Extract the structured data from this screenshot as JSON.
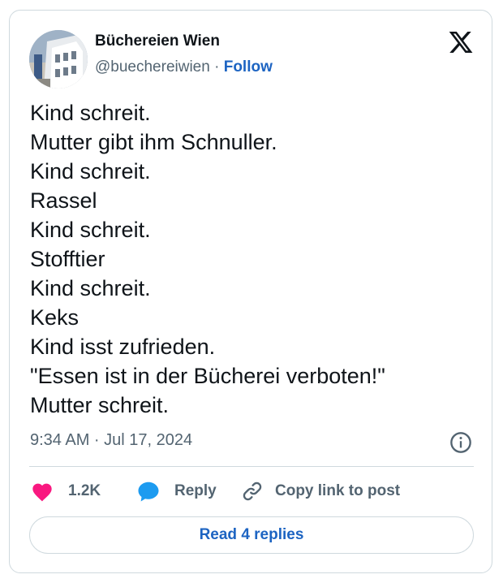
{
  "colors": {
    "accent": "#1d64c2",
    "heart": "#f91880",
    "secondary_text": "#536471",
    "border": "#cfd9de"
  },
  "author": {
    "name": "Büchereien Wien",
    "handle": "@buechereiwien",
    "separator": "·",
    "follow_label": "Follow"
  },
  "tweet": {
    "lines": [
      "Kind schreit.",
      "Mutter gibt ihm Schnuller.",
      "Kind schreit.",
      "Rassel",
      "Kind schreit.",
      "Stofftier",
      "Kind schreit.",
      "Keks",
      "Kind isst zufrieden.",
      "\"Essen ist in der Bücherei verboten!\"",
      "Mutter schreit."
    ],
    "timestamp": "9:34 AM · Jul 17, 2024"
  },
  "actions": {
    "like_count": "1.2K",
    "reply_label": "Reply",
    "copy_link_label": "Copy link to post"
  },
  "read_replies_label": "Read 4 replies",
  "icons": {
    "brand": "x-logo-icon",
    "info": "info-icon",
    "like": "heart-icon",
    "reply": "speech-bubble-icon",
    "copy": "link-icon"
  }
}
